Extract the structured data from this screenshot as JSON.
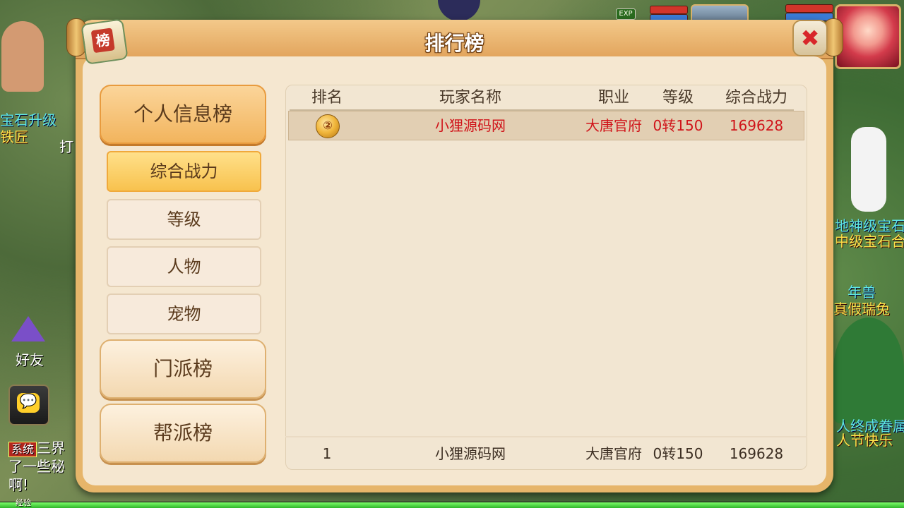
{
  "scene": {
    "labels_left": [
      "宝石升级",
      "铁匠",
      "打"
    ],
    "labels_right": [
      "地神级宝石",
      "中级宝石合",
      "年兽",
      "真假瑞兔",
      "人终成眷属",
      "人节快乐"
    ],
    "friend_label": "好友",
    "chat_icon": "💬",
    "chat_tag": "系统",
    "chat_line1": "三界",
    "chat_line2": "了一些秘",
    "chat_line3": "啊!",
    "exp_badge": "EXP",
    "exp_label": "经验"
  },
  "panel": {
    "title": "排行榜",
    "emblem": "榜",
    "close_label": "✖"
  },
  "menu": {
    "category_personal": "个人信息榜",
    "sub_power": "综合战力",
    "sub_level": "等级",
    "sub_character": "人物",
    "sub_pet": "宠物",
    "category_sect": "门派榜",
    "category_guild": "帮派榜"
  },
  "table": {
    "headers": {
      "rank": "排名",
      "player": "玩家名称",
      "job": "职业",
      "level": "等级",
      "power": "综合战力"
    },
    "rows": [
      {
        "rank_icon": "②",
        "player": "小狸源码网",
        "job": "大唐官府",
        "level": "0转150",
        "power": "169628"
      }
    ],
    "my_row": {
      "rank": "1",
      "player": "小狸源码网",
      "job": "大唐官府",
      "level": "0转150",
      "power": "169628"
    }
  },
  "colors": {
    "accent": "#e6b56a",
    "highlight_red": "#d0141a",
    "active_tab": "#f8c24e"
  }
}
